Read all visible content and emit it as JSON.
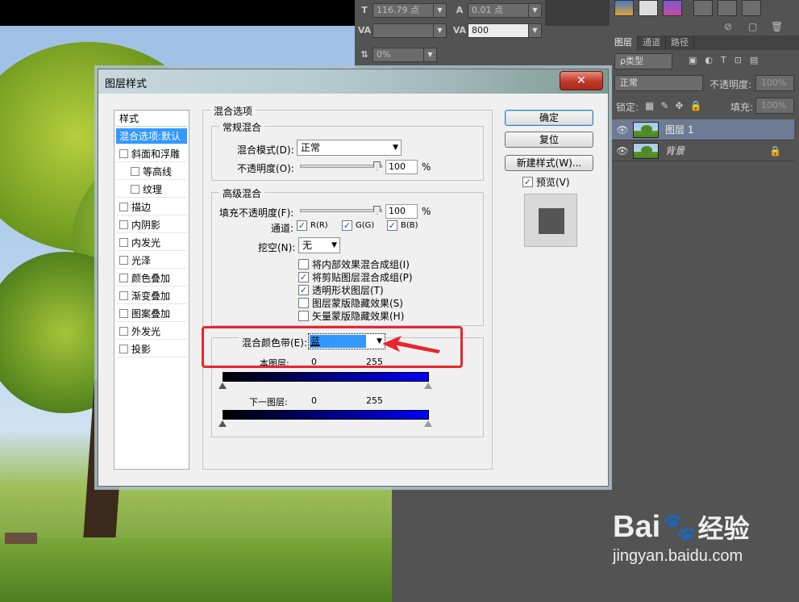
{
  "char_panel": {
    "font_size": "116.79 点",
    "tracking_label": "0.01 点",
    "kerning": "",
    "tracking": "800",
    "baseline": "0%"
  },
  "layers_panel": {
    "tabs": [
      "图层",
      "通道",
      "路径"
    ],
    "filter_kind": "ρ类型",
    "blend_mode": "正常",
    "opacity_label": "不透明度:",
    "opacity_value": "100%",
    "lock_label": "锁定:",
    "fill_label": "填充:",
    "fill_value": "100%",
    "layers": [
      {
        "name": "图层 1",
        "selected": true
      },
      {
        "name": "背景",
        "selected": false
      }
    ]
  },
  "dialog": {
    "title": "图层样式",
    "close_label": "✕",
    "style_list_header": "样式",
    "styles": [
      {
        "label": "混合选项:默认",
        "checkbox": false,
        "indent": false,
        "selected": true
      },
      {
        "label": "斜面和浮雕",
        "checkbox": true,
        "indent": false,
        "selected": false
      },
      {
        "label": "等高线",
        "checkbox": true,
        "indent": true,
        "selected": false
      },
      {
        "label": "纹理",
        "checkbox": true,
        "indent": true,
        "selected": false
      },
      {
        "label": "描边",
        "checkbox": true,
        "indent": false,
        "selected": false
      },
      {
        "label": "内阴影",
        "checkbox": true,
        "indent": false,
        "selected": false
      },
      {
        "label": "内发光",
        "checkbox": true,
        "indent": false,
        "selected": false
      },
      {
        "label": "光泽",
        "checkbox": true,
        "indent": false,
        "selected": false
      },
      {
        "label": "颜色叠加",
        "checkbox": true,
        "indent": false,
        "selected": false
      },
      {
        "label": "渐变叠加",
        "checkbox": true,
        "indent": false,
        "selected": false
      },
      {
        "label": "图案叠加",
        "checkbox": true,
        "indent": false,
        "selected": false
      },
      {
        "label": "外发光",
        "checkbox": true,
        "indent": false,
        "selected": false
      },
      {
        "label": "投影",
        "checkbox": true,
        "indent": false,
        "selected": false
      }
    ],
    "blending_options": {
      "title": "混合选项",
      "general": {
        "title": "常规混合",
        "blend_mode_label": "混合模式(D):",
        "blend_mode_value": "正常",
        "opacity_label": "不透明度(O):",
        "opacity_value": "100",
        "percent": "%"
      },
      "advanced": {
        "title": "高级混合",
        "fill_opacity_label": "填充不透明度(F):",
        "fill_opacity_value": "100",
        "percent": "%",
        "channels_label": "通道:",
        "channel_r": "R(R)",
        "channel_g": "G(G)",
        "channel_b": "B(B)",
        "knockout_label": "挖空(N):",
        "knockout_value": "无",
        "options": [
          {
            "label": "将内部效果混合成组(I)",
            "checked": false
          },
          {
            "label": "将剪贴图层混合成组(P)",
            "checked": true
          },
          {
            "label": "透明形状图层(T)",
            "checked": true
          },
          {
            "label": "图层蒙版隐藏效果(S)",
            "checked": false
          },
          {
            "label": "矢量蒙版隐藏效果(H)",
            "checked": false
          }
        ]
      },
      "blend_if": {
        "label": "混合颜色带(E):",
        "value": "蓝",
        "this_layer_label": "本图层:",
        "this_layer_min": "0",
        "this_layer_max": "255",
        "underlying_label": "下一图层:",
        "underlying_min": "0",
        "underlying_max": "255"
      }
    },
    "buttons": {
      "ok": "确定",
      "reset": "复位",
      "new_style": "新建样式(W)...",
      "preview": "预览(V)"
    }
  },
  "watermark": {
    "brand": "Bai",
    "brand2": "经验",
    "url": "jingyan.baidu.com"
  },
  "colors": {
    "selection": "#3399ff",
    "highlight_box": "#e8262c",
    "blend_bar_start": "#000000",
    "blend_bar_end": "#0000ff"
  }
}
